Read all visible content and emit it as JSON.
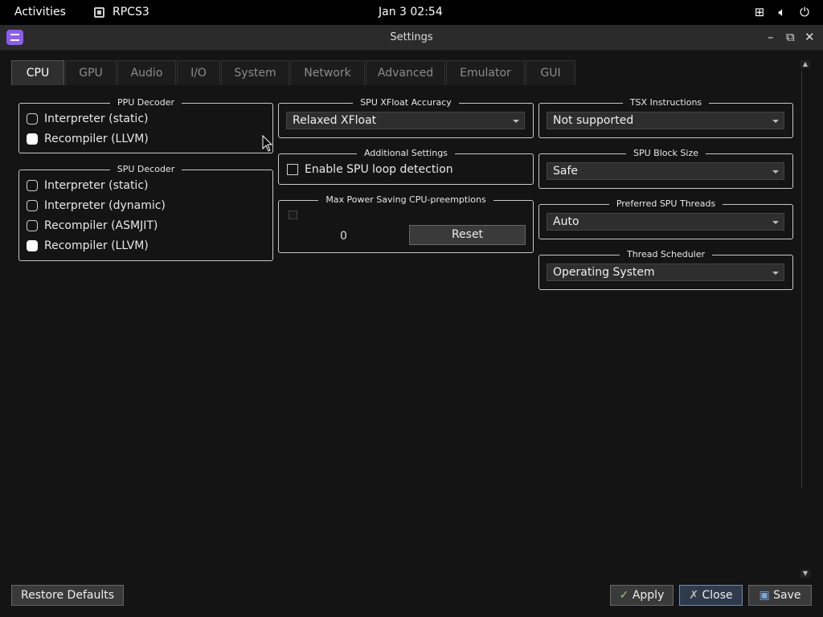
{
  "topbar": {
    "activities": "Activities",
    "app_name": "RPCS3",
    "clock": "Jan 3  02:54",
    "icons": [
      "network-icon",
      "volume-icon",
      "power-icon"
    ]
  },
  "window": {
    "title": "Settings",
    "controls": {
      "minimize": "–",
      "maximize": "⧉",
      "close": "✕"
    }
  },
  "tabs": [
    "CPU",
    "GPU",
    "Audio",
    "I/O",
    "System",
    "Network",
    "Advanced",
    "Emulator",
    "GUI"
  ],
  "active_tab": "CPU",
  "ppu_decoder": {
    "title": "PPU Decoder",
    "options": [
      {
        "label": "Interpreter (static)",
        "checked": false
      },
      {
        "label": "Recompiler (LLVM)",
        "checked": true
      }
    ]
  },
  "spu_decoder": {
    "title": "SPU Decoder",
    "options": [
      {
        "label": "Interpreter (static)",
        "checked": false
      },
      {
        "label": "Interpreter (dynamic)",
        "checked": false
      },
      {
        "label": "Recompiler (ASMJIT)",
        "checked": false
      },
      {
        "label": "Recompiler (LLVM)",
        "checked": true
      }
    ]
  },
  "spu_xfloat": {
    "title": "SPU XFloat Accuracy",
    "value": "Relaxed XFloat"
  },
  "additional": {
    "title": "Additional Settings",
    "loop_detection": "Enable SPU loop detection",
    "loop_detection_checked": false
  },
  "max_power": {
    "title": "Max Power Saving CPU-preemptions",
    "value": "0",
    "reset": "Reset",
    "enabled": false
  },
  "tsx": {
    "title": "TSX Instructions",
    "value": "Not supported"
  },
  "spu_block_size": {
    "title": "SPU Block Size",
    "value": "Safe"
  },
  "preferred_spu_threads": {
    "title": "Preferred SPU Threads",
    "value": "Auto"
  },
  "thread_scheduler": {
    "title": "Thread Scheduler",
    "value": "Operating System"
  },
  "footer": {
    "restore": "Restore Defaults",
    "apply": "Apply",
    "close": "Close",
    "save": "Save"
  }
}
